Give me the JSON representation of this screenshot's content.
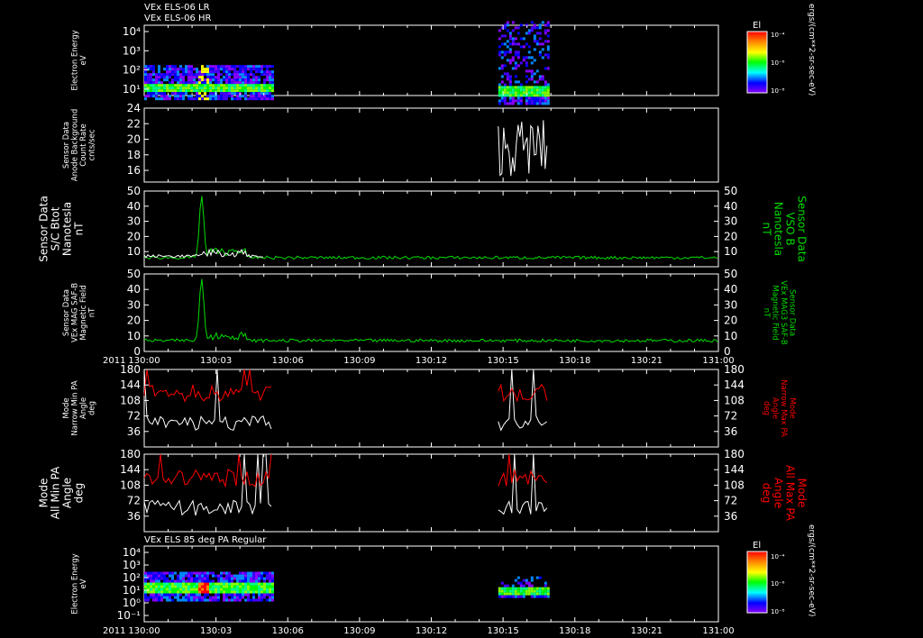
{
  "header": {
    "title_line1": "VEx ELS-06 LR",
    "title_line2": "VEx ELS-06 HR",
    "bottom_title": "VEx ELS 85 deg PA Regular"
  },
  "time_axis": {
    "year": "2011",
    "ticks": [
      "130:00",
      "130:03",
      "130:06",
      "130:09",
      "130:12",
      "130:15",
      "130:18",
      "130:21",
      "131:00"
    ]
  },
  "colorbars": {
    "title": "El",
    "tick_labels": [
      "10⁻⁴",
      "10⁻⁶",
      "10⁻⁸"
    ],
    "units": "ergs/(cm**2-sr-sec-eV)",
    "colors": [
      "#ff0000",
      "#ff8800",
      "#ffff00",
      "#00ff00",
      "#00ffff",
      "#0000ff",
      "#8800ff"
    ]
  },
  "colors": {
    "background": "#000000",
    "axes": "#ffffff",
    "field_line": "#00dd00",
    "field_label": "#00dd00",
    "max_pa": "#ff0000",
    "min_pa": "#ffffff"
  },
  "chart_data": [
    {
      "type": "heatmap",
      "panel": "Electron Energy (LR/HR)",
      "ylabel": [
        "Electron Energy",
        "eV"
      ],
      "y_ticks": [
        "10⁴",
        "10³",
        "10²",
        "10¹"
      ],
      "yscale": "log",
      "ylim": [
        10,
        10000
      ],
      "blocks": [
        {
          "t_start": "130:00",
          "t_end": "130:05.4",
          "energy_range_eV": [
            8,
            200
          ],
          "peak_band_eV": [
            15,
            40
          ]
        },
        {
          "t_start": "130:14.8",
          "t_end": "130:16.9",
          "energy_range_eV": [
            5,
            15000
          ],
          "peak_band_eV": [
            10,
            30
          ]
        }
      ]
    },
    {
      "type": "line",
      "panel": "Sensor Data Anode Background Count Rate",
      "ylabel": [
        "Sensor Data",
        "Anode Background",
        "Count Rate",
        "cnts/sec"
      ],
      "y_ticks": [
        "24",
        "22",
        "20",
        "18",
        "16"
      ],
      "ylim": [
        14.5,
        24
      ],
      "series": [
        {
          "color": "#ffffff",
          "t_range": [
            "130:14.8",
            "130:16.9"
          ],
          "values_min": 15.2,
          "values_max": 22.6
        }
      ]
    },
    {
      "type": "line",
      "panel": "S/C Btot",
      "ylabel": [
        "Sensor Data",
        "S/C Btot",
        "Nanotesla",
        "nT"
      ],
      "ylabel_right": [
        "Sensor Data",
        "VSO B",
        "Nanotesla",
        "nT"
      ],
      "y_ticks": [
        "50",
        "40",
        "30",
        "20",
        "10"
      ],
      "ylim": [
        0,
        50
      ],
      "series": [
        {
          "name": "Btot",
          "color": "#ffffff",
          "t_range": [
            "130:00",
            "130:05"
          ],
          "baseline_nT": 7
        },
        {
          "name": "VSO B",
          "color": "#00dd00",
          "t_range": [
            "130:00",
            "131:00"
          ],
          "baseline_nT": 6,
          "peak_nT": 47,
          "peak_time": "130:02.4"
        }
      ]
    },
    {
      "type": "line",
      "panel": "VEx MAG SAF-B Magnetic Field",
      "ylabel": [
        "Sensor Data",
        "VEx MAG SAF-B",
        "Magnetic Field",
        "nT"
      ],
      "ylabel_right": [
        "Sensor Data",
        "VEx MAG3 SAF-B",
        "Magnetic Field",
        "nT"
      ],
      "y_ticks": [
        "50",
        "40",
        "30",
        "20",
        "10",
        "0"
      ],
      "ylim": [
        0,
        50
      ],
      "series": [
        {
          "name": "SAF-B",
          "color": "#00dd00",
          "t_range": [
            "130:00",
            "131:00"
          ],
          "baseline_nT": 7,
          "peak_nT": 47,
          "peak_time": "130:02.4"
        }
      ]
    },
    {
      "type": "line",
      "panel": "Mode Narrow Min/Max PA Angle",
      "ylabel": [
        "Mode",
        "Narrow Min PA",
        "Angle",
        "deg"
      ],
      "ylabel_right": [
        "Mode",
        "Narrow Max PA",
        "Angle",
        "deg"
      ],
      "y_ticks": [
        "180",
        "144",
        "108",
        "72",
        "36"
      ],
      "ylim": [
        0,
        180
      ],
      "series": [
        {
          "name": "Min PA",
          "color": "#ffffff",
          "t_ranges": [
            [
              "130:00",
              "130:05.4"
            ],
            [
              "130:14.8",
              "130:16.9"
            ]
          ]
        },
        {
          "name": "Max PA",
          "color": "#ff0000",
          "t_ranges": [
            [
              "130:00",
              "130:05.4"
            ],
            [
              "130:14.8",
              "130:16.9"
            ]
          ]
        }
      ]
    },
    {
      "type": "line",
      "panel": "Mode All Min/Max PA Angle",
      "ylabel": [
        "Mode",
        "All Min PA",
        "Angle",
        "deg"
      ],
      "ylabel_right": [
        "Mode",
        "All Max PA",
        "Angle",
        "deg"
      ],
      "y_ticks": [
        "180",
        "144",
        "108",
        "72",
        "36"
      ],
      "ylim": [
        0,
        180
      ],
      "series": [
        {
          "name": "Min PA",
          "color": "#ffffff",
          "t_ranges": [
            [
              "130:00",
              "130:05.4"
            ],
            [
              "130:14.8",
              "130:16.9"
            ]
          ]
        },
        {
          "name": "Max PA",
          "color": "#ff0000",
          "t_ranges": [
            [
              "130:00",
              "130:05.4"
            ],
            [
              "130:14.8",
              "130:16.9"
            ]
          ]
        }
      ]
    },
    {
      "type": "heatmap",
      "panel": "Electron Energy (85 deg PA)",
      "ylabel": [
        "Electron Energy",
        "eV"
      ],
      "y_ticks": [
        "10⁴",
        "10³",
        "10²",
        "10¹",
        "10⁰",
        "10⁻¹"
      ],
      "yscale": "log",
      "ylim": [
        0.1,
        10000
      ],
      "blocks": [
        {
          "t_start": "130:00",
          "t_end": "130:05.4",
          "energy_range_eV": [
            3,
            200
          ],
          "peak_band_eV": [
            8,
            40
          ]
        },
        {
          "t_start": "130:14.8",
          "t_end": "130:16.9",
          "energy_range_eV": [
            5,
            100
          ],
          "peak_band_eV": [
            8,
            25
          ]
        }
      ]
    }
  ]
}
